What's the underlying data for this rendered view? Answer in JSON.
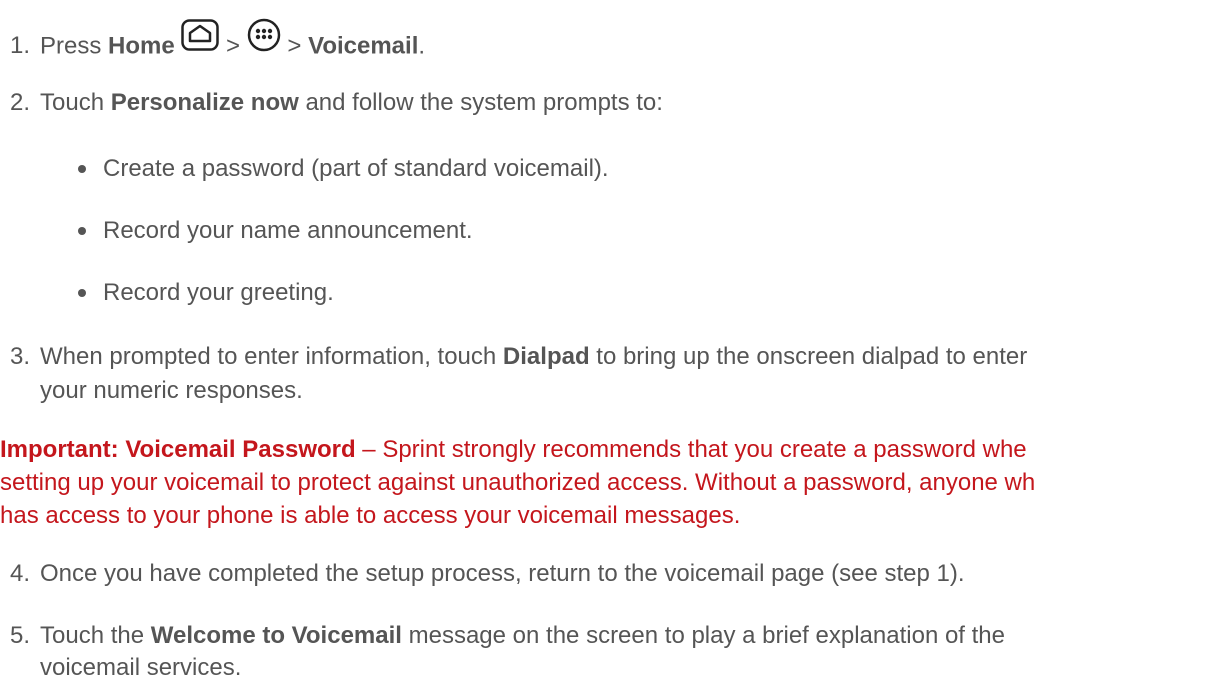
{
  "step1": {
    "number": "1.",
    "prefix": "Press ",
    "home": "Home",
    "sep1": " > ",
    "sep2": " > ",
    "voicemail": "Voicemail",
    "end": "."
  },
  "step2": {
    "number": "2.",
    "prefix": "Touch ",
    "bold": "Personalize now",
    "suffix": " and follow the system prompts to:",
    "bullets": [
      "Create a password (part of standard voicemail).",
      "Record your name announcement.",
      "Record your greeting."
    ]
  },
  "step3": {
    "number": "3.",
    "prefix": "When prompted to enter information, touch ",
    "bold": "Dialpad",
    "suffix": " to bring up the onscreen dialpad to enter",
    "line2": "your numeric responses."
  },
  "important": {
    "label": "Important: Voicemail Password",
    "line1": " – Sprint strongly recommends that you create a password whe",
    "line2": "setting up your voicemail to protect against unauthorized access. Without a password, anyone wh",
    "line3": "has access to your phone is able to access your voicemail messages."
  },
  "step4": {
    "number": "4.",
    "text": "Once you have completed the setup process, return to the voicemail page (see step 1)."
  },
  "step5": {
    "number": "5.",
    "prefix": "Touch the ",
    "bold": "Welcome to Voicemail",
    "suffix": " message on the screen to play a brief explanation of the",
    "line2": "voicemail services."
  },
  "icons": {
    "home": "home-icon",
    "apps": "all-apps-icon"
  },
  "colors": {
    "text": "#555555",
    "important": "#c4161c"
  }
}
